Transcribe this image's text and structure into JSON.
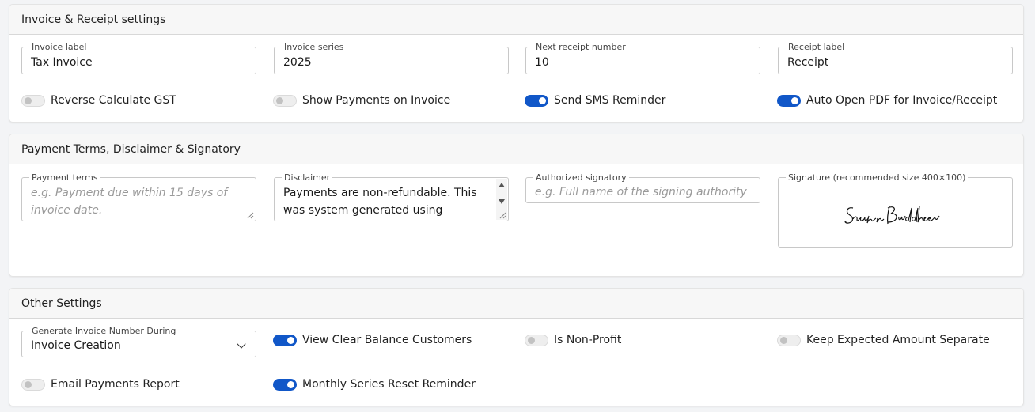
{
  "invoice_section": {
    "title": "Invoice & Receipt settings",
    "fields": [
      {
        "label": "Invoice label",
        "value": "Tax Invoice"
      },
      {
        "label": "Invoice series",
        "value": "2025"
      },
      {
        "label": "Next receipt number",
        "value": "10"
      },
      {
        "label": "Receipt label",
        "value": "Receipt"
      }
    ],
    "toggles": [
      {
        "label": "Reverse Calculate GST",
        "on": false
      },
      {
        "label": "Show Payments on Invoice",
        "on": false
      },
      {
        "label": "Send SMS Reminder",
        "on": true
      },
      {
        "label": "Auto Open PDF for Invoice/Receipt",
        "on": true
      }
    ]
  },
  "terms_section": {
    "title": "Payment Terms, Disclaimer & Signatory",
    "payment_terms": {
      "label": "Payment terms",
      "placeholder": "e.g. Payment due within 15 days of invoice date."
    },
    "disclaimer": {
      "label": "Disclaimer",
      "value": "Payments are non-refundable. This was system generated using"
    },
    "signatory": {
      "label": "Authorized signatory",
      "placeholder": "e.g. Full name of the signing authority"
    },
    "signature": {
      "label": "Signature (recommended size 400×100)",
      "image_text": "Sachin Buddhadev"
    }
  },
  "other_section": {
    "title": "Other Settings",
    "generate_select": {
      "label": "Generate Invoice Number During",
      "value": "Invoice Creation"
    },
    "toggles": [
      {
        "label": "View Clear Balance Customers",
        "on": true
      },
      {
        "label": "Is Non-Profit",
        "on": false
      },
      {
        "label": "Keep Expected Amount Separate",
        "on": false
      },
      {
        "label": "Email Payments Report",
        "on": false
      },
      {
        "label": "Monthly Series Reset Reminder",
        "on": true
      }
    ]
  },
  "colors": {
    "toggle_on": "#1157c8",
    "toggle_off": "#eeeeee",
    "header_bg": "#f7f7f7"
  }
}
